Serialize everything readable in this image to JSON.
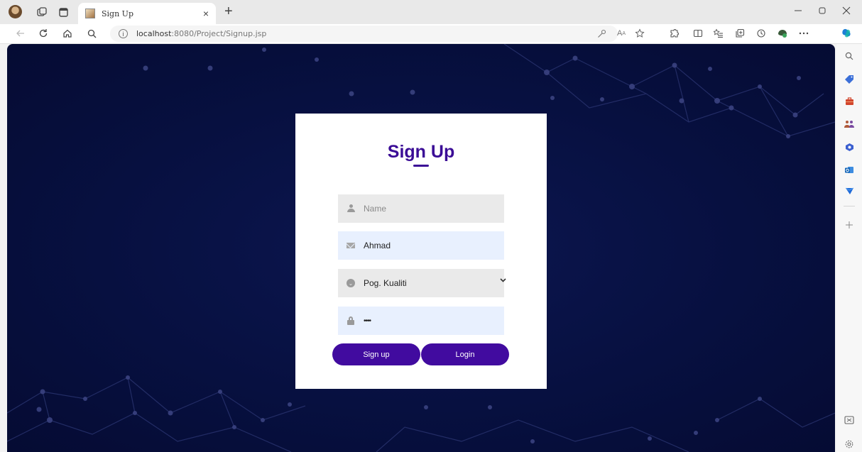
{
  "browser": {
    "tab_title": "Sign Up",
    "url_host": "localhost",
    "url_rest": ":8080/Project/Signup.jsp",
    "tab_close": "×",
    "new_tab": "+"
  },
  "form": {
    "title": "Sign Up",
    "name_placeholder": "Name",
    "email_value": "Ahmad",
    "role_value": "Pog. Kualiti",
    "password_value": "••••",
    "signup_label": "Sign up",
    "login_label": "Login"
  },
  "colors": {
    "accent": "#410b9f",
    "title": "#3b0d96",
    "background": "#071040",
    "card": "#ffffff",
    "autofill": "#e8f0fe"
  }
}
